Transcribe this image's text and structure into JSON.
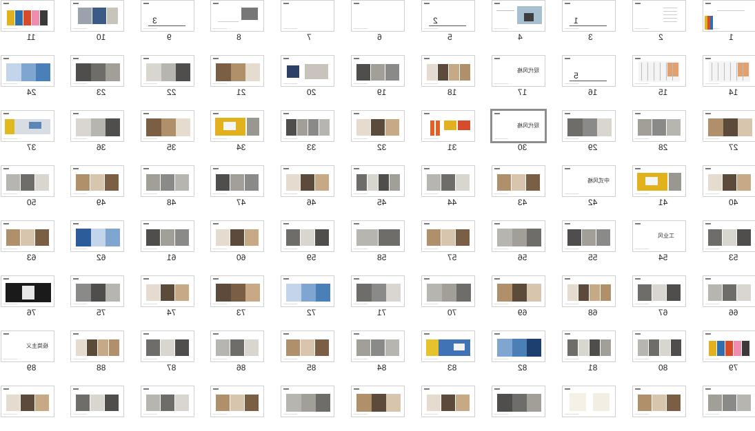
{
  "slides": [
    {
      "n": "1",
      "v": "cover"
    },
    {
      "n": "2",
      "v": "toc"
    },
    {
      "n": "3",
      "v": "divider",
      "label": "1"
    },
    {
      "n": "4",
      "v": "stone"
    },
    {
      "n": "5",
      "v": "divider",
      "label": "2"
    },
    {
      "n": "6",
      "v": "blank"
    },
    {
      "n": "7",
      "v": "blank"
    },
    {
      "n": "8",
      "v": "textimg"
    },
    {
      "n": "9",
      "v": "divider",
      "label": "3"
    },
    {
      "n": "10",
      "v": "triple"
    },
    {
      "n": "11",
      "v": "colorful"
    },
    {
      "n": "14",
      "v": "plan"
    },
    {
      "n": "15",
      "v": "plan"
    },
    {
      "n": "16",
      "v": "divider",
      "label": "5"
    },
    {
      "n": "17",
      "v": "title",
      "label": "现代风格"
    },
    {
      "n": "18",
      "v": "photos4"
    },
    {
      "n": "19",
      "v": "photos3"
    },
    {
      "n": "20",
      "v": "diagram"
    },
    {
      "n": "21",
      "v": "wide"
    },
    {
      "n": "22",
      "v": "wide"
    },
    {
      "n": "23",
      "v": "wide"
    },
    {
      "n": "24",
      "v": "wide"
    },
    {
      "n": "27",
      "v": "wide"
    },
    {
      "n": "28",
      "v": "photos3"
    },
    {
      "n": "29",
      "v": "wide"
    },
    {
      "n": "30",
      "v": "title",
      "label": "现代风格",
      "selected": true
    },
    {
      "n": "31",
      "v": "orange"
    },
    {
      "n": "32",
      "v": "photos3"
    },
    {
      "n": "33",
      "v": "photos4"
    },
    {
      "n": "34",
      "v": "yellow"
    },
    {
      "n": "35",
      "v": "wide"
    },
    {
      "n": "36",
      "v": "wide"
    },
    {
      "n": "37",
      "v": "yellowwide"
    },
    {
      "n": "40",
      "v": "photos3"
    },
    {
      "n": "41",
      "v": "yellow"
    },
    {
      "n": "42",
      "v": "title",
      "label": "中式风格"
    },
    {
      "n": "43",
      "v": "photos3"
    },
    {
      "n": "44",
      "v": "photos3"
    },
    {
      "n": "45",
      "v": "photos4"
    },
    {
      "n": "46",
      "v": "photos3"
    },
    {
      "n": "47",
      "v": "photos3"
    },
    {
      "n": "48",
      "v": "photos3"
    },
    {
      "n": "49",
      "v": "photos3"
    },
    {
      "n": "50",
      "v": "photos3"
    },
    {
      "n": "53",
      "v": "photos3"
    },
    {
      "n": "54",
      "v": "title",
      "label": "工业风"
    },
    {
      "n": "55",
      "v": "photos3"
    },
    {
      "n": "56",
      "v": "wide"
    },
    {
      "n": "57",
      "v": "photos3"
    },
    {
      "n": "58",
      "v": "photos2"
    },
    {
      "n": "59",
      "v": "photos3"
    },
    {
      "n": "60",
      "v": "photos3"
    },
    {
      "n": "61",
      "v": "photos3"
    },
    {
      "n": "62",
      "v": "wide"
    },
    {
      "n": "63",
      "v": "photos3"
    },
    {
      "n": "66",
      "v": "photos3"
    },
    {
      "n": "67",
      "v": "photos3"
    },
    {
      "n": "68",
      "v": "photos4"
    },
    {
      "n": "69",
      "v": "wide"
    },
    {
      "n": "70",
      "v": "wide"
    },
    {
      "n": "71",
      "v": "wide"
    },
    {
      "n": "72",
      "v": "wide"
    },
    {
      "n": "73",
      "v": "wide"
    },
    {
      "n": "74",
      "v": "photos3"
    },
    {
      "n": "75",
      "v": "wide"
    },
    {
      "n": "76",
      "v": "dark"
    },
    {
      "n": "79",
      "v": "colorful"
    },
    {
      "n": "80",
      "v": "photos4"
    },
    {
      "n": "81",
      "v": "photos4"
    },
    {
      "n": "82",
      "v": "wide"
    },
    {
      "n": "83",
      "v": "blue"
    },
    {
      "n": "84",
      "v": "photos3"
    },
    {
      "n": "85",
      "v": "photos3"
    },
    {
      "n": "86",
      "v": "photos3"
    },
    {
      "n": "87",
      "v": "photos3"
    },
    {
      "n": "88",
      "v": "photos4"
    },
    {
      "n": "89",
      "v": "title",
      "label": "极简主义"
    },
    {
      "n": "",
      "v": "photos3"
    },
    {
      "n": "",
      "v": "photos3"
    },
    {
      "n": "",
      "v": "sketch"
    },
    {
      "n": "",
      "v": "wide"
    },
    {
      "n": "",
      "v": "photos3"
    },
    {
      "n": "",
      "v": "wide"
    },
    {
      "n": "",
      "v": "wide"
    },
    {
      "n": "",
      "v": "photos3"
    },
    {
      "n": "",
      "v": "photos3"
    },
    {
      "n": "",
      "v": "photos3"
    },
    {
      "n": "",
      "v": "photos3"
    }
  ]
}
